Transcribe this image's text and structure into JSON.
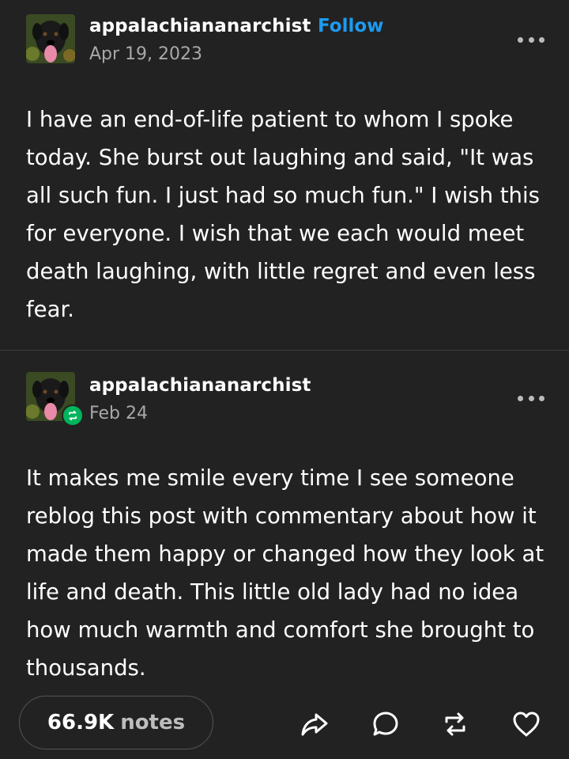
{
  "posts": [
    {
      "username": "appalachiananarchist",
      "follow_label": "Follow",
      "date": "Apr 19, 2023",
      "body": "I have an end-of-life patient to whom I spoke today. She burst out laughing and said, \"It was all such fun. I just had so much fun.\" I wish this for everyone. I wish that we each would meet death laughing, with little regret and even less fear."
    },
    {
      "username": "appalachiananarchist",
      "date": "Feb 24",
      "body": "It makes me smile every time I see someone reblog this post with commentary about how it made them happy or changed how they look at life and death. This little old lady had no idea how much warmth and comfort she brought to thousands."
    }
  ],
  "footer": {
    "notes_count": "66.9K",
    "notes_label": "notes"
  },
  "icons": {
    "avatar": "dog-avatar",
    "badge": "reblog-badge-icon",
    "more": "more-options-icon",
    "share": "share-icon",
    "reply": "reply-icon",
    "reblog": "reblog-icon",
    "like": "heart-icon"
  },
  "colors": {
    "background": "#222222",
    "follow_accent": "#1d9bf0",
    "reblog_badge": "#00b35c"
  }
}
